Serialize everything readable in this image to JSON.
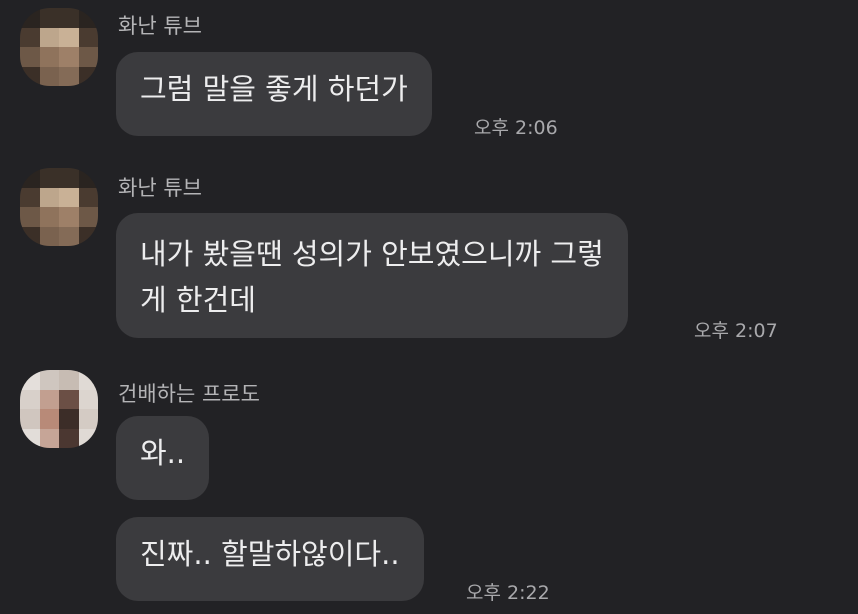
{
  "messages": [
    {
      "sender": "화난 튜브",
      "text_lines": [
        "그럼 말을 좋게 하던가"
      ],
      "time": "오후 2:06"
    },
    {
      "sender": "화난 튜브",
      "text_lines": [
        "내가 봤을땐 성의가 안보였으니까 그렇",
        "게 한건데"
      ],
      "time": "오후 2:07"
    },
    {
      "sender": "건배하는 프로도",
      "text_lines": [
        "와.."
      ],
      "time": ""
    },
    {
      "sender": "",
      "text_lines": [
        "진짜.. 할말하않이다.."
      ],
      "time": "오후 2:22"
    }
  ],
  "colors": {
    "background": "#222225",
    "bubble": "#3b3b3e",
    "text": "#ededee",
    "sender": "#b4b4b6",
    "time": "#a9a9ac"
  }
}
